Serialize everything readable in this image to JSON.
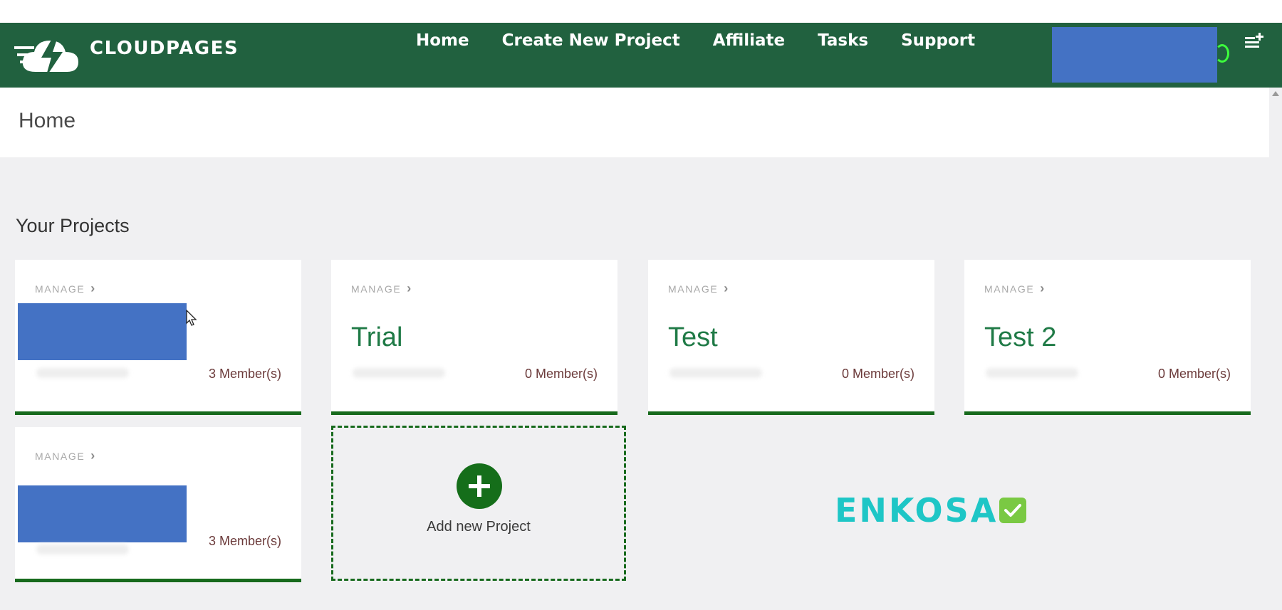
{
  "app": {
    "brand": "CLOUDPAGES"
  },
  "nav": {
    "links": [
      "Home",
      "Create New Project",
      "Affiliate",
      "Tasks",
      "Support"
    ]
  },
  "header": {
    "page_title": "Home"
  },
  "projects": {
    "section_title": "Your Projects",
    "manage_label": "MANAGE",
    "cards": [
      {
        "title": "",
        "members": "3 Member(s)",
        "redacted": true
      },
      {
        "title": "Trial",
        "members": "0 Member(s)",
        "redacted": false
      },
      {
        "title": "Test",
        "members": "0 Member(s)",
        "redacted": false
      },
      {
        "title": "Test 2",
        "members": "0 Member(s)",
        "redacted": false
      },
      {
        "title": "",
        "members": "3 Member(s)",
        "redacted": true
      }
    ],
    "add_label": "Add new Project"
  },
  "watermark": {
    "text": "ENKOSA"
  },
  "colors": {
    "navbar": "#21613f",
    "accent": "#176a1d",
    "title_green": "#1f7a46",
    "redaction": "#4472c4",
    "watermark": "#1ec6c6"
  },
  "icons": [
    "cloud-bolt-logo-icon",
    "chevron-right-icon",
    "plus-icon",
    "menu-add-icon",
    "mouse-cursor-icon",
    "check-icon"
  ]
}
